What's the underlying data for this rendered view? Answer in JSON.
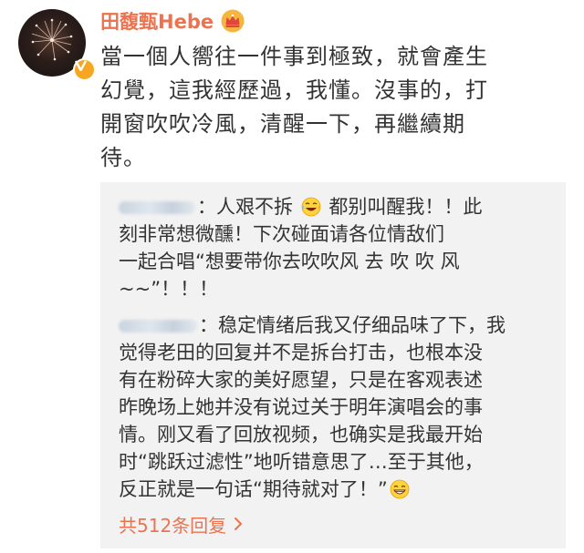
{
  "user": {
    "name": "田馥甄Hebe",
    "avatar_icon": "firework-avatar",
    "badge_icon": "verified-v-icon",
    "member_icon": "crown-icon"
  },
  "post": {
    "lines": [
      "當一個人嚮往一件事到極致，就會產生",
      "幻覺，這我經歷過，我懂。沒事的，打",
      "開窗吹吹冷風，清醒一下，再繼續期",
      "待。"
    ]
  },
  "replies": [
    {
      "line1_rest": "人艰不拆",
      "line1_after_emoji": " 都别叫醒我！！此",
      "lines": [
        "刻非常想微醺！下次碰面请各位情敌们",
        "一起合唱“想要带你去吹吹风 去 吹 吹 风",
        "~~”！！！"
      ]
    },
    {
      "line1_rest": "稳定情绪后我又仔细品味了下，我",
      "lines": [
        "觉得老田的回复并不是拆台打击，也根本没",
        "有在粉碎大家的美好愿望，只是在客观表述",
        "昨晚场上她并没有说过关于明年演唱会的事",
        "情。刚又看了回放视频，也确实是我最开始",
        "时“跳跃过滤性”地听错意思了…至于其他，",
        "反正就是一句话“期待就对了！”"
      ]
    }
  ],
  "more_replies": "共512条回复",
  "colors": {
    "accent": "#eb7350",
    "reply_bg": "#f2f2f2",
    "text": "#333333"
  }
}
